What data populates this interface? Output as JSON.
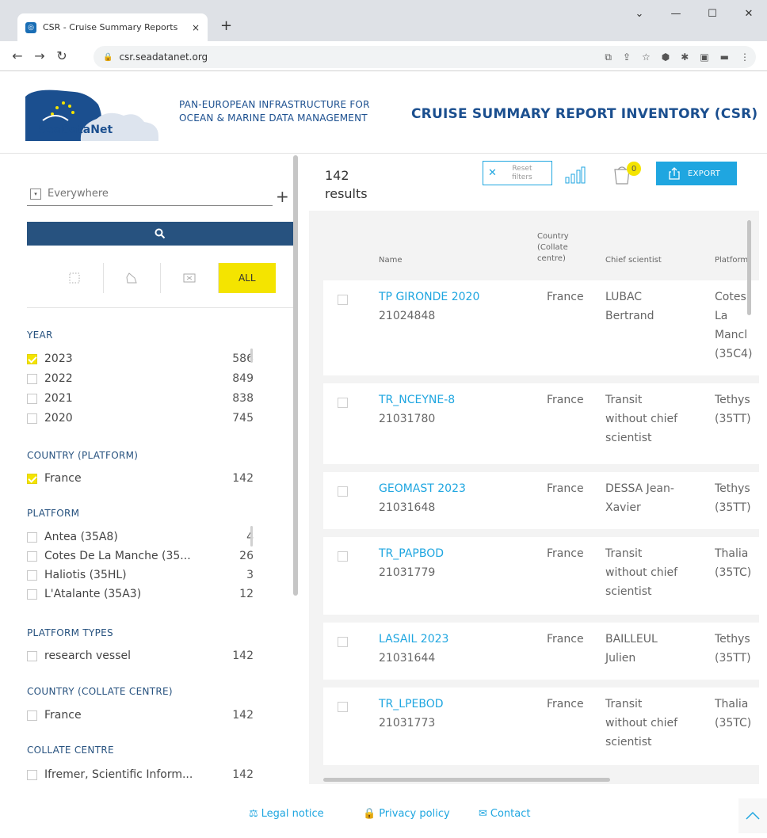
{
  "browser": {
    "tab_title": "CSR - Cruise Summary Reports",
    "tab_close": "×",
    "new_tab": "+",
    "url": "csr.seadatanet.org"
  },
  "header": {
    "logo_text": "SeaDataNet",
    "tagline_line1": "PAN-EUROPEAN INFRASTRUCTURE FOR",
    "tagline_line2": "OCEAN & MARINE DATA MANAGEMENT",
    "title": "CRUISE SUMMARY REPORT INVENTORY (CSR)"
  },
  "search": {
    "placeholder": "Everywhere",
    "add_label": "+"
  },
  "geo_tabs": {
    "all_label": "ALL"
  },
  "facets": {
    "year": {
      "title": "YEAR",
      "items": [
        {
          "label": "2023",
          "count": "586",
          "checked": true
        },
        {
          "label": "2022",
          "count": "849",
          "checked": false
        },
        {
          "label": "2021",
          "count": "838",
          "checked": false
        },
        {
          "label": "2020",
          "count": "745",
          "checked": false
        }
      ]
    },
    "country_platform": {
      "title": "COUNTRY (PLATFORM)",
      "items": [
        {
          "label": "France",
          "count": "142",
          "checked": true
        }
      ]
    },
    "platform": {
      "title": "PLATFORM",
      "items": [
        {
          "label": "Antea (35A8)",
          "count": "4",
          "checked": false
        },
        {
          "label": "Cotes De La Manche (35...",
          "count": "26",
          "checked": false
        },
        {
          "label": "Haliotis (35HL)",
          "count": "3",
          "checked": false
        },
        {
          "label": "L'Atalante (35A3)",
          "count": "12",
          "checked": false
        }
      ]
    },
    "platform_types": {
      "title": "PLATFORM TYPES",
      "items": [
        {
          "label": "research vessel",
          "count": "142",
          "checked": false
        }
      ]
    },
    "country_collate": {
      "title": "COUNTRY (COLLATE CENTRE)",
      "items": [
        {
          "label": "France",
          "count": "142",
          "checked": false
        }
      ]
    },
    "collate_centre": {
      "title": "COLLATE CENTRE",
      "items": [
        {
          "label": "Ifremer, Scientific Inform...",
          "count": "142",
          "checked": false
        }
      ]
    }
  },
  "results": {
    "count": "142",
    "label": "results",
    "reset_label_1": "Reset",
    "reset_label_2": "filters",
    "basket_count": "0",
    "export_label": "EXPORT"
  },
  "table": {
    "columns": {
      "name": "Name",
      "country_1": "Country",
      "country_2": "(Collate",
      "country_3": "centre)",
      "chief": "Chief scientist",
      "platform": "Platform"
    },
    "rows": [
      {
        "name": "TP GIRONDE 2020",
        "id": "21024848",
        "country": "France",
        "chief": [
          "LUBAC",
          "Bertrand"
        ],
        "platform": [
          "Cotes",
          "La",
          "Mancl",
          "(35C4)"
        ]
      },
      {
        "name": "TR_NCEYNE-8",
        "id": "21031780",
        "country": "France",
        "chief": [
          "Transit",
          "without chief",
          "scientist"
        ],
        "platform": [
          "Tethys",
          "(35TT)"
        ]
      },
      {
        "name": "GEOMAST 2023",
        "id": "21031648",
        "country": "France",
        "chief": [
          "DESSA Jean-",
          "Xavier"
        ],
        "platform": [
          "Tethys",
          "(35TT)"
        ]
      },
      {
        "name": "TR_PAPBOD",
        "id": "21031779",
        "country": "France",
        "chief": [
          "Transit",
          "without chief",
          "scientist"
        ],
        "platform": [
          "Thalia",
          "(35TC)"
        ]
      },
      {
        "name": "LASAIL 2023",
        "id": "21031644",
        "country": "France",
        "chief": [
          "BAILLEUL",
          "Julien"
        ],
        "platform": [
          "Tethys",
          "(35TT)"
        ]
      },
      {
        "name": "TR_LPEBOD",
        "id": "21031773",
        "country": "France",
        "chief": [
          "Transit",
          "without chief",
          "scientist"
        ],
        "platform": [
          "Thalia",
          "(35TC)"
        ]
      }
    ]
  },
  "footer": {
    "legal": "Legal notice",
    "privacy": "Privacy policy",
    "contact": "Contact"
  },
  "colors": {
    "brand_blue": "#27527f",
    "accent_cyan": "#1fa6e0",
    "highlight_yellow": "#f4e400"
  }
}
